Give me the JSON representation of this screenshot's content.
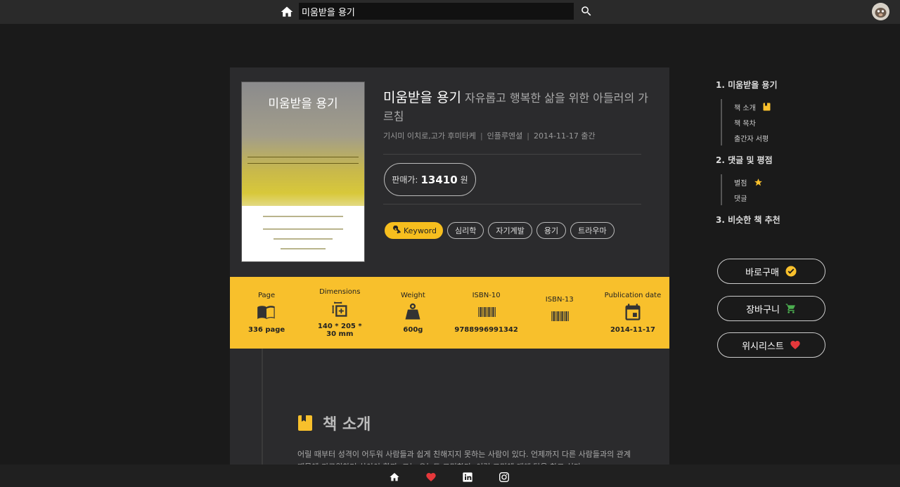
{
  "search": {
    "value": "미움받을 용기"
  },
  "book": {
    "title": "미움받을 용기",
    "subtitle": "자유롭고 행복한 삶을 위한 아들러의 가르침",
    "authors": "기시미 이치로,고가 후미타케",
    "publisher": "인플루엔셜",
    "date_label": "2014-11-17 출간",
    "cover_title": "미움받을 용기"
  },
  "price": {
    "label": "판매가:",
    "value": "13410",
    "unit": "원"
  },
  "tags": {
    "keyword_label": "Keyword",
    "items": [
      "심리학",
      "자기계발",
      "용기",
      "트라우마"
    ]
  },
  "specs": [
    {
      "label": "Page",
      "value": "336 page",
      "icon": "book-open-icon"
    },
    {
      "label": "Dimensions",
      "value": "140 * 205 * 30 mm",
      "icon": "dimensions-icon"
    },
    {
      "label": "Weight",
      "value": "600g",
      "icon": "weight-icon"
    },
    {
      "label": "ISBN-10",
      "value": "9788996991342",
      "icon": "barcode-icon"
    },
    {
      "label": "ISBN-13",
      "value": "",
      "icon": "barcode-icon"
    },
    {
      "label": "Publication date",
      "value": "2014-11-17",
      "icon": "calendar-icon"
    }
  ],
  "intro": {
    "heading": "책 소개",
    "text": "어릴 때부터 성격이 어두워 사람들과 쉽게 친해지지 못하는 사람이 있다. 언제까지 다른 사람들과의 관계 때문에 괴로워하며 살아야 할까. 그는 오늘도 고민한다. 이런 고민에 대해 답을 찾고 싶다."
  },
  "toc": {
    "s1": "1. 미움받을 용기",
    "s1_items": [
      "책 소개",
      "책 목차",
      "출간자 서평"
    ],
    "s2": "2. 댓글 및 평점",
    "s2_items": [
      "별점",
      "댓글"
    ],
    "s3": "3. 비슷한 책 추천"
  },
  "actions": {
    "buy": "바로구매",
    "cart": "장바구니",
    "wish": "위시리스트"
  },
  "colors": {
    "accent": "#f8c02c",
    "heart": "#e5383b",
    "cart": "#4caf50"
  }
}
